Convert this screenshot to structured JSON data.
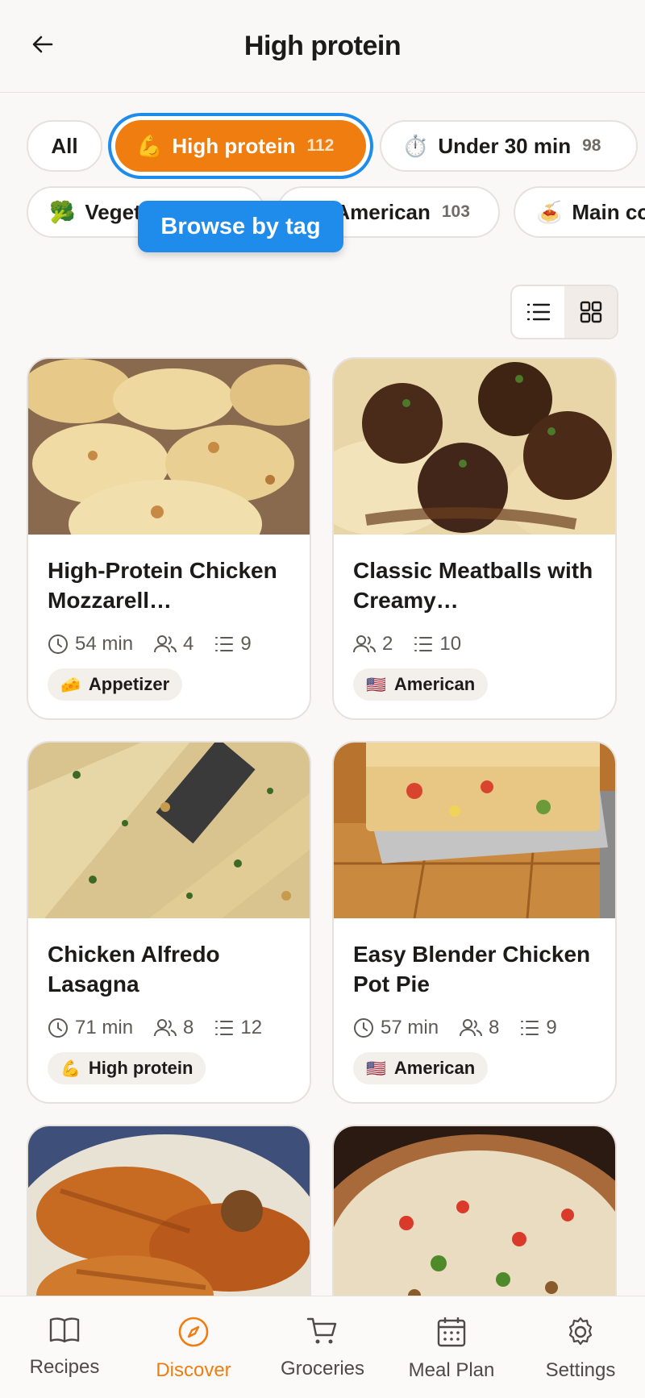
{
  "header": {
    "title": "High protein",
    "back_icon": "arrow-left-icon"
  },
  "chips_row1": [
    {
      "emoji": "",
      "label": "All",
      "count": ""
    },
    {
      "emoji": "💪",
      "label": "High protein",
      "count": "112",
      "active": true
    },
    {
      "emoji": "⏱️",
      "label": "Under 30 min",
      "count": "98"
    }
  ],
  "chips_row2": [
    {
      "emoji": "🥦",
      "label": "Vegetarian",
      "count": ""
    },
    {
      "emoji": "🇺🇸",
      "label": "American",
      "count": "103"
    },
    {
      "emoji": "🍝",
      "label": "Main course",
      "count": ""
    }
  ],
  "tooltip": "Browse by tag",
  "view_toggle": {
    "list_icon": "list-icon",
    "grid_icon": "grid-icon",
    "selected": "grid"
  },
  "recipes": [
    {
      "name": "High-Protein Chicken Mozzarell…",
      "time": "54 min",
      "servings": "4",
      "steps": "9",
      "tag_emoji": "🧀",
      "tag": "Appetizer"
    },
    {
      "name": "Classic Meatballs with Creamy…",
      "time": "",
      "servings": "2",
      "steps": "10",
      "tag_emoji": "🇺🇸",
      "tag": "American"
    },
    {
      "name": "Chicken Alfredo Lasagna",
      "time": "71 min",
      "servings": "8",
      "steps": "12",
      "tag_emoji": "💪",
      "tag": "High protein"
    },
    {
      "name": "Easy Blender Chicken Pot Pie",
      "time": "57 min",
      "servings": "8",
      "steps": "9",
      "tag_emoji": "🇺🇸",
      "tag": "American"
    }
  ],
  "tabbar": [
    {
      "label": "Recipes",
      "icon": "book-icon"
    },
    {
      "label": "Discover",
      "icon": "compass-icon",
      "active": true
    },
    {
      "label": "Groceries",
      "icon": "cart-icon"
    },
    {
      "label": "Meal Plan",
      "icon": "calendar-icon"
    },
    {
      "label": "Settings",
      "icon": "gear-icon"
    }
  ],
  "colors": {
    "accent": "#ef7d0f",
    "focus": "#1f8ceb",
    "background": "#faf8f6"
  }
}
